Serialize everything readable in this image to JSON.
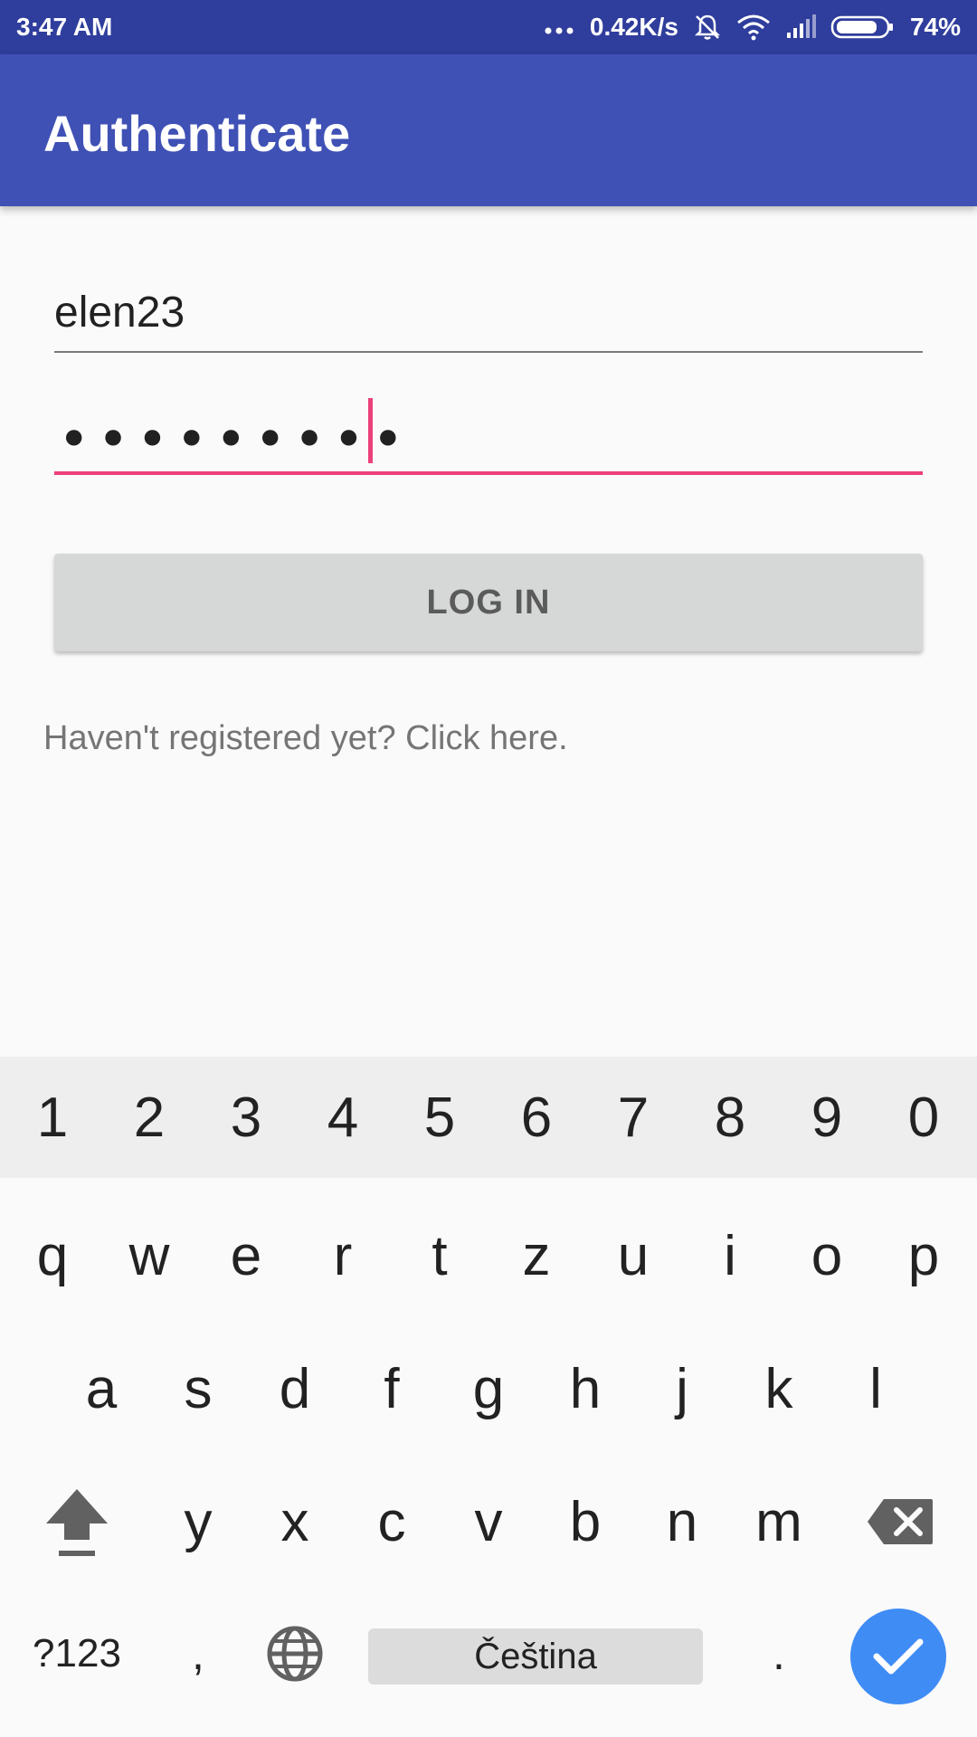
{
  "status_bar": {
    "time": "3:47 AM",
    "network_speed": "0.42K/s",
    "battery": "74%",
    "battery_level": 0.74,
    "icons": [
      "more-dots-icon",
      "bell-off-icon",
      "wifi-icon",
      "signal-icon",
      "battery-icon"
    ]
  },
  "app_bar": {
    "title": "Authenticate",
    "color": "#3f51b5"
  },
  "form": {
    "username_value": "elen23",
    "password_mask": "•••••••••",
    "login_label": "LOG IN",
    "register_text": "Haven't registered yet? Click here.",
    "accent_color": "#ec407a"
  },
  "keyboard": {
    "numbers": [
      "1",
      "2",
      "3",
      "4",
      "5",
      "6",
      "7",
      "8",
      "9",
      "0"
    ],
    "row1": [
      "q",
      "w",
      "e",
      "r",
      "t",
      "z",
      "u",
      "i",
      "o",
      "p"
    ],
    "row2": [
      "a",
      "s",
      "d",
      "f",
      "g",
      "h",
      "j",
      "k",
      "l"
    ],
    "row3": [
      "y",
      "x",
      "c",
      "v",
      "b",
      "n",
      "m"
    ],
    "symbols_label": "?123",
    "comma_label": ",",
    "space_label": "Čeština",
    "period_label": ".",
    "icons": [
      "shift-icon",
      "backspace-icon",
      "globe-icon",
      "check-icon"
    ]
  }
}
